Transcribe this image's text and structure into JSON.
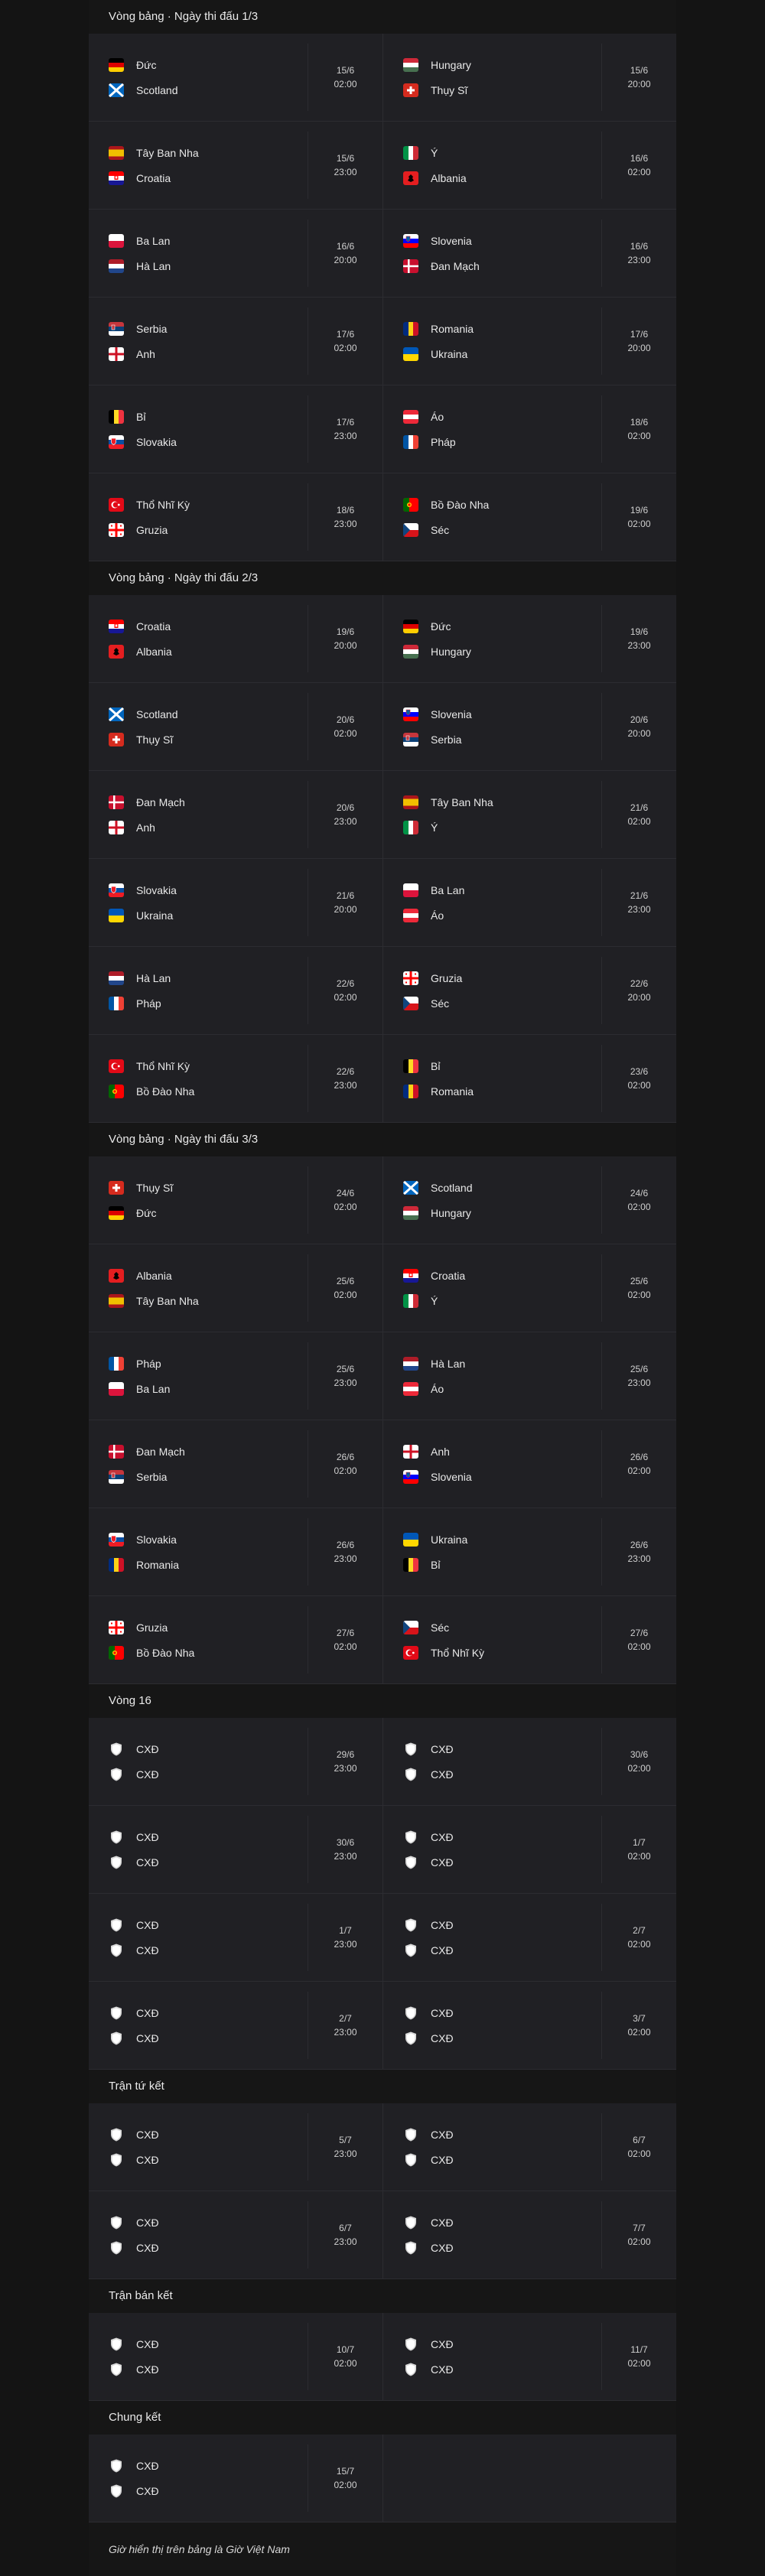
{
  "sections": [
    {
      "title": "Vòng bảng · Ngày thi đấu 1/3",
      "rows": [
        [
          {
            "teams": [
              {
                "name": "Đức",
                "flag": "de"
              },
              {
                "name": "Scotland",
                "flag": "sco"
              }
            ],
            "date": "15/6",
            "time": "02:00"
          },
          {
            "teams": [
              {
                "name": "Hungary",
                "flag": "hu"
              },
              {
                "name": "Thụy Sĩ",
                "flag": "ch"
              }
            ],
            "date": "15/6",
            "time": "20:00"
          }
        ],
        [
          {
            "teams": [
              {
                "name": "Tây Ban Nha",
                "flag": "es"
              },
              {
                "name": "Croatia",
                "flag": "hr"
              }
            ],
            "date": "15/6",
            "time": "23:00"
          },
          {
            "teams": [
              {
                "name": "Ý",
                "flag": "it"
              },
              {
                "name": "Albania",
                "flag": "al"
              }
            ],
            "date": "16/6",
            "time": "02:00"
          }
        ],
        [
          {
            "teams": [
              {
                "name": "Ba Lan",
                "flag": "pl"
              },
              {
                "name": "Hà Lan",
                "flag": "nl"
              }
            ],
            "date": "16/6",
            "time": "20:00"
          },
          {
            "teams": [
              {
                "name": "Slovenia",
                "flag": "si"
              },
              {
                "name": "Đan Mạch",
                "flag": "dk"
              }
            ],
            "date": "16/6",
            "time": "23:00"
          }
        ],
        [
          {
            "teams": [
              {
                "name": "Serbia",
                "flag": "rs"
              },
              {
                "name": "Anh",
                "flag": "eng"
              }
            ],
            "date": "17/6",
            "time": "02:00"
          },
          {
            "teams": [
              {
                "name": "Romania",
                "flag": "ro"
              },
              {
                "name": "Ukraina",
                "flag": "ua"
              }
            ],
            "date": "17/6",
            "time": "20:00"
          }
        ],
        [
          {
            "teams": [
              {
                "name": "Bỉ",
                "flag": "be"
              },
              {
                "name": "Slovakia",
                "flag": "sk"
              }
            ],
            "date": "17/6",
            "time": "23:00"
          },
          {
            "teams": [
              {
                "name": "Áo",
                "flag": "at"
              },
              {
                "name": "Pháp",
                "flag": "fr"
              }
            ],
            "date": "18/6",
            "time": "02:00"
          }
        ],
        [
          {
            "teams": [
              {
                "name": "Thổ Nhĩ Kỳ",
                "flag": "tr"
              },
              {
                "name": "Gruzia",
                "flag": "ge"
              }
            ],
            "date": "18/6",
            "time": "23:00"
          },
          {
            "teams": [
              {
                "name": "Bồ Đào Nha",
                "flag": "pt"
              },
              {
                "name": "Séc",
                "flag": "cz"
              }
            ],
            "date": "19/6",
            "time": "02:00"
          }
        ]
      ]
    },
    {
      "title": "Vòng bảng · Ngày thi đấu 2/3",
      "rows": [
        [
          {
            "teams": [
              {
                "name": "Croatia",
                "flag": "hr"
              },
              {
                "name": "Albania",
                "flag": "al"
              }
            ],
            "date": "19/6",
            "time": "20:00"
          },
          {
            "teams": [
              {
                "name": "Đức",
                "flag": "de"
              },
              {
                "name": "Hungary",
                "flag": "hu"
              }
            ],
            "date": "19/6",
            "time": "23:00"
          }
        ],
        [
          {
            "teams": [
              {
                "name": "Scotland",
                "flag": "sco"
              },
              {
                "name": "Thụy Sĩ",
                "flag": "ch"
              }
            ],
            "date": "20/6",
            "time": "02:00"
          },
          {
            "teams": [
              {
                "name": "Slovenia",
                "flag": "si"
              },
              {
                "name": "Serbia",
                "flag": "rs"
              }
            ],
            "date": "20/6",
            "time": "20:00"
          }
        ],
        [
          {
            "teams": [
              {
                "name": "Đan Mạch",
                "flag": "dk"
              },
              {
                "name": "Anh",
                "flag": "eng"
              }
            ],
            "date": "20/6",
            "time": "23:00"
          },
          {
            "teams": [
              {
                "name": "Tây Ban Nha",
                "flag": "es"
              },
              {
                "name": "Ý",
                "flag": "it"
              }
            ],
            "date": "21/6",
            "time": "02:00"
          }
        ],
        [
          {
            "teams": [
              {
                "name": "Slovakia",
                "flag": "sk"
              },
              {
                "name": "Ukraina",
                "flag": "ua"
              }
            ],
            "date": "21/6",
            "time": "20:00"
          },
          {
            "teams": [
              {
                "name": "Ba Lan",
                "flag": "pl"
              },
              {
                "name": "Áo",
                "flag": "at"
              }
            ],
            "date": "21/6",
            "time": "23:00"
          }
        ],
        [
          {
            "teams": [
              {
                "name": "Hà Lan",
                "flag": "nl"
              },
              {
                "name": "Pháp",
                "flag": "fr"
              }
            ],
            "date": "22/6",
            "time": "02:00"
          },
          {
            "teams": [
              {
                "name": "Gruzia",
                "flag": "ge"
              },
              {
                "name": "Séc",
                "flag": "cz"
              }
            ],
            "date": "22/6",
            "time": "20:00"
          }
        ],
        [
          {
            "teams": [
              {
                "name": "Thổ Nhĩ Kỳ",
                "flag": "tr"
              },
              {
                "name": "Bồ Đào Nha",
                "flag": "pt"
              }
            ],
            "date": "22/6",
            "time": "23:00"
          },
          {
            "teams": [
              {
                "name": "Bỉ",
                "flag": "be"
              },
              {
                "name": "Romania",
                "flag": "ro"
              }
            ],
            "date": "23/6",
            "time": "02:00"
          }
        ]
      ]
    },
    {
      "title": "Vòng bảng · Ngày thi đấu 3/3",
      "rows": [
        [
          {
            "teams": [
              {
                "name": "Thụy Sĩ",
                "flag": "ch"
              },
              {
                "name": "Đức",
                "flag": "de"
              }
            ],
            "date": "24/6",
            "time": "02:00"
          },
          {
            "teams": [
              {
                "name": "Scotland",
                "flag": "sco"
              },
              {
                "name": "Hungary",
                "flag": "hu"
              }
            ],
            "date": "24/6",
            "time": "02:00"
          }
        ],
        [
          {
            "teams": [
              {
                "name": "Albania",
                "flag": "al"
              },
              {
                "name": "Tây Ban Nha",
                "flag": "es"
              }
            ],
            "date": "25/6",
            "time": "02:00"
          },
          {
            "teams": [
              {
                "name": "Croatia",
                "flag": "hr"
              },
              {
                "name": "Ý",
                "flag": "it"
              }
            ],
            "date": "25/6",
            "time": "02:00"
          }
        ],
        [
          {
            "teams": [
              {
                "name": "Pháp",
                "flag": "fr"
              },
              {
                "name": "Ba Lan",
                "flag": "pl"
              }
            ],
            "date": "25/6",
            "time": "23:00"
          },
          {
            "teams": [
              {
                "name": "Hà Lan",
                "flag": "nl"
              },
              {
                "name": "Áo",
                "flag": "at"
              }
            ],
            "date": "25/6",
            "time": "23:00"
          }
        ],
        [
          {
            "teams": [
              {
                "name": "Đan Mạch",
                "flag": "dk"
              },
              {
                "name": "Serbia",
                "flag": "rs"
              }
            ],
            "date": "26/6",
            "time": "02:00"
          },
          {
            "teams": [
              {
                "name": "Anh",
                "flag": "eng"
              },
              {
                "name": "Slovenia",
                "flag": "si"
              }
            ],
            "date": "26/6",
            "time": "02:00"
          }
        ],
        [
          {
            "teams": [
              {
                "name": "Slovakia",
                "flag": "sk"
              },
              {
                "name": "Romania",
                "flag": "ro"
              }
            ],
            "date": "26/6",
            "time": "23:00"
          },
          {
            "teams": [
              {
                "name": "Ukraina",
                "flag": "ua"
              },
              {
                "name": "Bỉ",
                "flag": "be"
              }
            ],
            "date": "26/6",
            "time": "23:00"
          }
        ],
        [
          {
            "teams": [
              {
                "name": "Gruzia",
                "flag": "ge"
              },
              {
                "name": "Bồ Đào Nha",
                "flag": "pt"
              }
            ],
            "date": "27/6",
            "time": "02:00"
          },
          {
            "teams": [
              {
                "name": "Séc",
                "flag": "cz"
              },
              {
                "name": "Thổ Nhĩ Kỳ",
                "flag": "tr"
              }
            ],
            "date": "27/6",
            "time": "02:00"
          }
        ]
      ]
    },
    {
      "title": "Vòng 16",
      "rows": [
        [
          {
            "teams": [
              {
                "name": "CXĐ",
                "flag": "tbd"
              },
              {
                "name": "CXĐ",
                "flag": "tbd"
              }
            ],
            "date": "29/6",
            "time": "23:00"
          },
          {
            "teams": [
              {
                "name": "CXĐ",
                "flag": "tbd"
              },
              {
                "name": "CXĐ",
                "flag": "tbd"
              }
            ],
            "date": "30/6",
            "time": "02:00"
          }
        ],
        [
          {
            "teams": [
              {
                "name": "CXĐ",
                "flag": "tbd"
              },
              {
                "name": "CXĐ",
                "flag": "tbd"
              }
            ],
            "date": "30/6",
            "time": "23:00"
          },
          {
            "teams": [
              {
                "name": "CXĐ",
                "flag": "tbd"
              },
              {
                "name": "CXĐ",
                "flag": "tbd"
              }
            ],
            "date": "1/7",
            "time": "02:00"
          }
        ],
        [
          {
            "teams": [
              {
                "name": "CXĐ",
                "flag": "tbd"
              },
              {
                "name": "CXĐ",
                "flag": "tbd"
              }
            ],
            "date": "1/7",
            "time": "23:00"
          },
          {
            "teams": [
              {
                "name": "CXĐ",
                "flag": "tbd"
              },
              {
                "name": "CXĐ",
                "flag": "tbd"
              }
            ],
            "date": "2/7",
            "time": "02:00"
          }
        ],
        [
          {
            "teams": [
              {
                "name": "CXĐ",
                "flag": "tbd"
              },
              {
                "name": "CXĐ",
                "flag": "tbd"
              }
            ],
            "date": "2/7",
            "time": "23:00"
          },
          {
            "teams": [
              {
                "name": "CXĐ",
                "flag": "tbd"
              },
              {
                "name": "CXĐ",
                "flag": "tbd"
              }
            ],
            "date": "3/7",
            "time": "02:00"
          }
        ]
      ]
    },
    {
      "title": "Trận tứ kết",
      "rows": [
        [
          {
            "teams": [
              {
                "name": "CXĐ",
                "flag": "tbd"
              },
              {
                "name": "CXĐ",
                "flag": "tbd"
              }
            ],
            "date": "5/7",
            "time": "23:00"
          },
          {
            "teams": [
              {
                "name": "CXĐ",
                "flag": "tbd"
              },
              {
                "name": "CXĐ",
                "flag": "tbd"
              }
            ],
            "date": "6/7",
            "time": "02:00"
          }
        ],
        [
          {
            "teams": [
              {
                "name": "CXĐ",
                "flag": "tbd"
              },
              {
                "name": "CXĐ",
                "flag": "tbd"
              }
            ],
            "date": "6/7",
            "time": "23:00"
          },
          {
            "teams": [
              {
                "name": "CXĐ",
                "flag": "tbd"
              },
              {
                "name": "CXĐ",
                "flag": "tbd"
              }
            ],
            "date": "7/7",
            "time": "02:00"
          }
        ]
      ]
    },
    {
      "title": "Trận bán kết",
      "rows": [
        [
          {
            "teams": [
              {
                "name": "CXĐ",
                "flag": "tbd"
              },
              {
                "name": "CXĐ",
                "flag": "tbd"
              }
            ],
            "date": "10/7",
            "time": "02:00"
          },
          {
            "teams": [
              {
                "name": "CXĐ",
                "flag": "tbd"
              },
              {
                "name": "CXĐ",
                "flag": "tbd"
              }
            ],
            "date": "11/7",
            "time": "02:00"
          }
        ]
      ]
    },
    {
      "title": "Chung kết",
      "rows": [
        [
          {
            "teams": [
              {
                "name": "CXĐ",
                "flag": "tbd"
              },
              {
                "name": "CXĐ",
                "flag": "tbd"
              }
            ],
            "date": "15/7",
            "time": "02:00"
          },
          null
        ]
      ]
    }
  ],
  "footnote": "Giờ hiển thị trên bảng là Giờ Việt Nam"
}
